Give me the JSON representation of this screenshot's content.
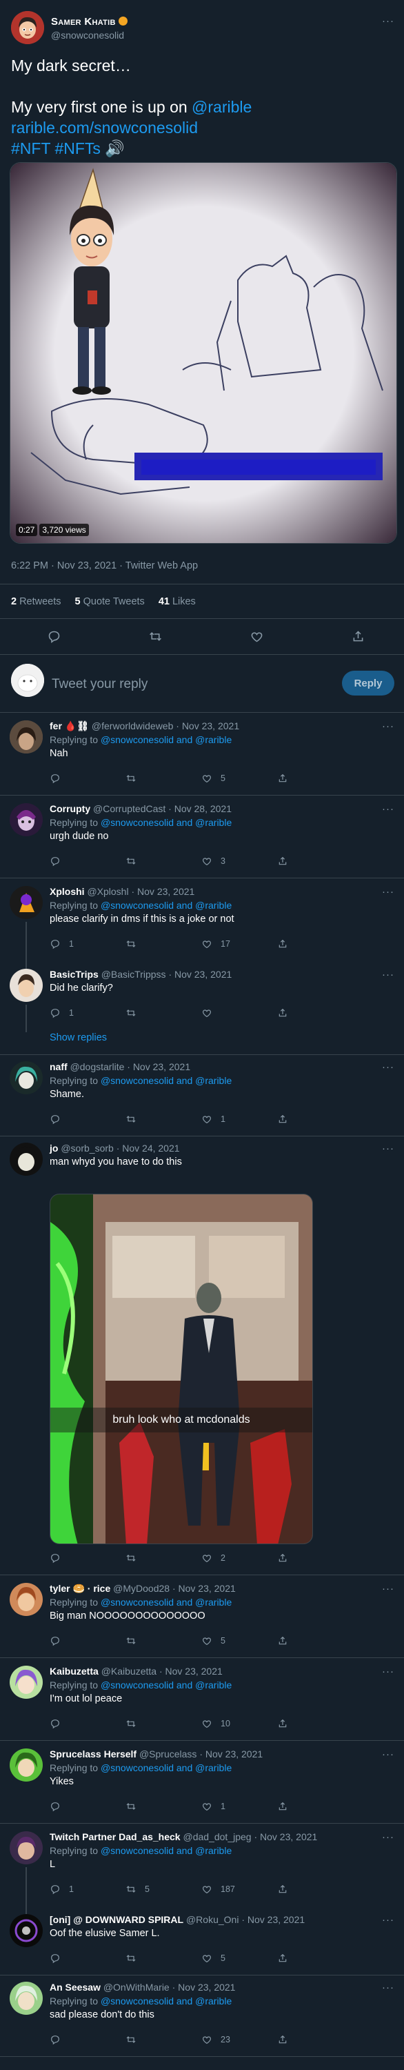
{
  "author": {
    "name": "Samer Khatib",
    "handle": "@snowconesolid"
  },
  "tweet": {
    "line1": "My dark secret…",
    "line2_prefix": "My very first one is up on ",
    "mention": "@rarible",
    "link": "rarible.com/snowconesolid",
    "hashtags": "#NFT #NFTs",
    "sound_icon": "🔊"
  },
  "media": {
    "duration": "0:27",
    "views": "3,720 views"
  },
  "meta": "6:22 PM · Nov 23, 2021 · Twitter Web App",
  "stats": {
    "retweets_count": "2",
    "retweets_label": "Retweets",
    "quotes_count": "5",
    "quotes_label": "Quote Tweets",
    "likes_count": "41",
    "likes_label": "Likes"
  },
  "reply_box": {
    "placeholder": "Tweet your reply",
    "button": "Reply"
  },
  "more_icon": "···",
  "replies": [
    {
      "name": "fer 🩸⛓",
      "handle": "@ferworldwideweb",
      "date": "· Nov 23, 2021",
      "replying": "Replying to",
      "to": "@snowconesolid and @rarible",
      "text": "Nah",
      "reply_count": "",
      "retweet_count": "",
      "like_count": "5"
    },
    {
      "name": "Corrupty",
      "handle": "@CorruptedCast",
      "date": "· Nov 28, 2021",
      "replying": "Replying to",
      "to": "@snowconesolid and @rarible",
      "text": "urgh dude no",
      "reply_count": "",
      "retweet_count": "",
      "like_count": "3"
    },
    {
      "name": "Xploshi",
      "handle": "@Xploshl",
      "date": "· Nov 23, 2021",
      "replying": "Replying to",
      "to": "@snowconesolid and @rarible",
      "text": "please clarify in dms if this is a joke or not",
      "reply_count": "1",
      "retweet_count": "",
      "like_count": "17"
    },
    {
      "name": "BasicTrips",
      "handle": "@BasicTrippss",
      "date": "· Nov 23, 2021",
      "text": "Did he clarify?",
      "reply_count": "1",
      "retweet_count": "",
      "like_count": ""
    },
    {
      "name": "naff",
      "handle": "@dogstarlite",
      "date": "· Nov 23, 2021",
      "replying": "Replying to",
      "to": "@snowconesolid and @rarible",
      "text": "Shame.",
      "reply_count": "",
      "retweet_count": "",
      "like_count": "1"
    },
    {
      "name": "jo",
      "handle": "@sorb_sorb",
      "date": "· Nov 24, 2021",
      "text": "man whyd you have to do this",
      "caption": "bruh look who at mcdonalds",
      "reply_count": "",
      "retweet_count": "",
      "like_count": "2"
    },
    {
      "name": "tyler 🥯 · rice",
      "handle": "@MyDood28",
      "date": "· Nov 23, 2021",
      "replying": "Replying to",
      "to": "@snowconesolid and @rarible",
      "text": "Big man NOOOOOOOOOOOOOO",
      "reply_count": "",
      "retweet_count": "",
      "like_count": "5"
    },
    {
      "name": "Kaibuzetta",
      "handle": "@Kaibuzetta",
      "date": "· Nov 23, 2021",
      "replying": "Replying to",
      "to": "@snowconesolid and @rarible",
      "text": "I'm out lol peace",
      "reply_count": "",
      "retweet_count": "",
      "like_count": "10"
    },
    {
      "name": "Sprucelass Herself",
      "handle": "@Sprucelass",
      "date": "· Nov 23, 2021",
      "replying": "Replying to",
      "to": "@snowconesolid and @rarible",
      "text": "Yikes",
      "reply_count": "",
      "retweet_count": "",
      "like_count": "1"
    },
    {
      "name": "Twitch Partner Dad_as_heck",
      "handle": "@dad_dot_jpeg",
      "date": "· Nov 23, 2021",
      "replying": "Replying to",
      "to": "@snowconesolid and @rarible",
      "text": "L",
      "reply_count": "1",
      "retweet_count": "5",
      "like_count": "187"
    },
    {
      "name": "[oni] @ DOWNWARD SPIRAL",
      "handle": "@Roku_Oni",
      "date": "· Nov 23, 2021",
      "text": "Oof the elusive Samer L.",
      "reply_count": "",
      "retweet_count": "",
      "like_count": "5"
    },
    {
      "name": "An Seesaw",
      "handle": "@OnWithMarie",
      "date": "· Nov 23, 2021",
      "replying": "Replying to",
      "to": "@snowconesolid and @rarible",
      "text": "sad please don't do this",
      "reply_count": "",
      "retweet_count": "",
      "like_count": "23"
    }
  ],
  "show_replies": "Show replies",
  "colors": {
    "background": "#15202b",
    "accent": "#1d9bf0",
    "secondary_text": "#8899a6",
    "border": "#38444d"
  }
}
